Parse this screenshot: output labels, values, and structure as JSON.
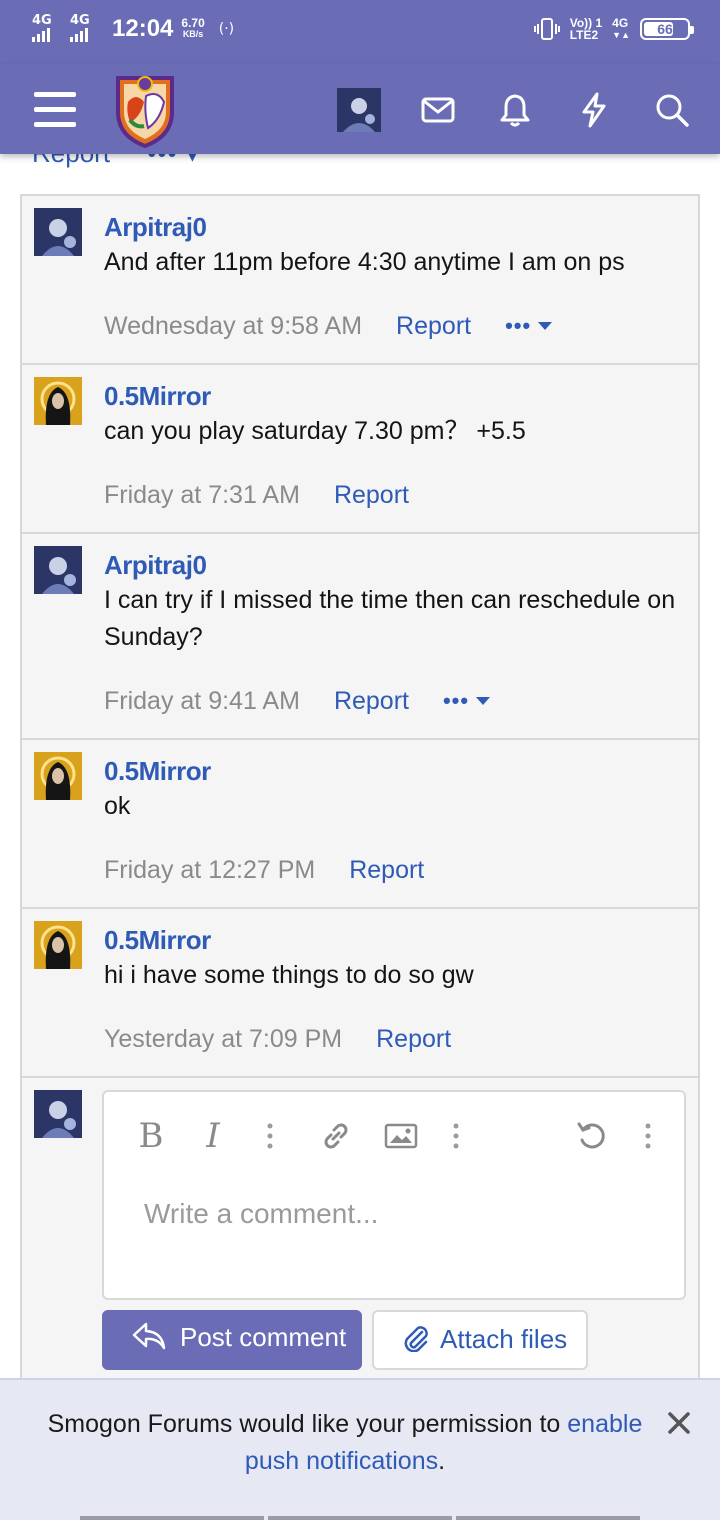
{
  "status_bar": {
    "network_1": "4G",
    "network_2": "4G",
    "time": "12:04",
    "speed_value": "6.70",
    "speed_unit": "KB/s",
    "sim_label_top": "Vo)) 1",
    "sim_label_bottom": "LTE2",
    "network_3": "4G",
    "battery": "66"
  },
  "app_bar": {
    "icons": [
      "menu-icon",
      "forum-logo",
      "user-avatar",
      "mail-icon",
      "bell-icon",
      "bolt-icon",
      "search-icon"
    ]
  },
  "previous_comment": {
    "report": "Report",
    "more": "•••"
  },
  "comments": [
    {
      "user": "Arpitraj0",
      "text": "And after 11pm before 4:30 anytime I am on ps",
      "date": "Wednesday at 9:58 AM",
      "report": "Report",
      "more": "•••",
      "avatar": "blue"
    },
    {
      "user": "0.5Mirror",
      "text": "can you play saturday 7.30 pm？ +5.5",
      "date": "Friday at 7:31 AM",
      "report": "Report",
      "more": "",
      "avatar": "gold"
    },
    {
      "user": "Arpitraj0",
      "text": "I can try if I missed the time then can reschedule on Sunday?",
      "date": "Friday at 9:41 AM",
      "report": "Report",
      "more": "•••",
      "avatar": "blue"
    },
    {
      "user": "0.5Mirror",
      "text": "ok",
      "date": "Friday at 12:27 PM",
      "report": "Report",
      "more": "",
      "avatar": "gold"
    },
    {
      "user": "0.5Mirror",
      "text": "hi i have some things to do so gw",
      "date": "Yesterday at 7:09 PM",
      "report": "Report",
      "more": "",
      "avatar": "gold"
    }
  ],
  "composer": {
    "bold": "B",
    "italic": "I",
    "placeholder": "Write a comment...",
    "post_button": "Post comment",
    "attach_button": "Attach files"
  },
  "notification": {
    "text_before": "Smogon Forums would like your permission to ",
    "link": "enable push notifications",
    "text_after": "."
  },
  "colors": {
    "brand": "#6a6cb6",
    "link": "#2f5bb7",
    "muted": "#8a8a8a"
  }
}
